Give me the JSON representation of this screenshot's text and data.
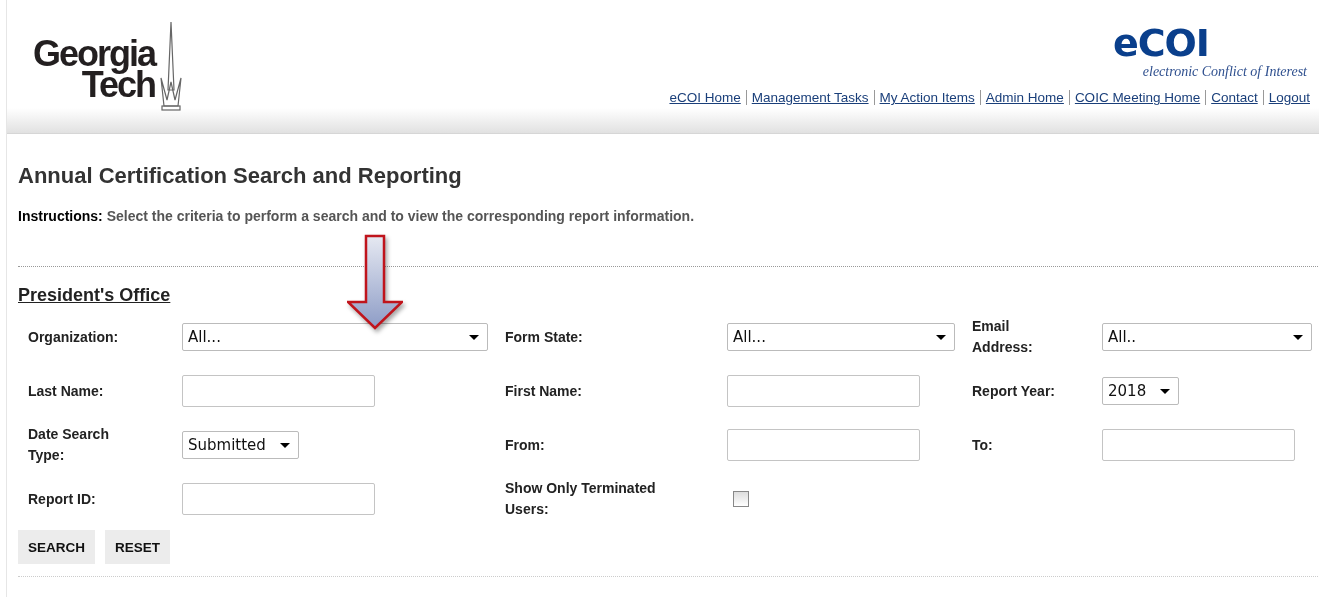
{
  "header": {
    "logo": {
      "line1": "Georgia",
      "line2": "Tech"
    },
    "app_logo": {
      "name": "eCOI",
      "tagline": "electronic Conflict of Interest"
    },
    "nav_links": [
      "eCOI Home",
      "Management Tasks",
      "My Action Items",
      "Admin Home",
      "COIC Meeting Home",
      "Contact",
      "Logout"
    ]
  },
  "page": {
    "title": "Annual Certification Search and Reporting",
    "instructions": "**Instructions:** Select the criteria to perform a search and to view the corresponding report information.",
    "section": "President's Office",
    "fields": [
      {
        "label": "Organization:",
        "kind": "select",
        "value": "All..."
      },
      {
        "label": "Form State:",
        "kind": "select",
        "value": "All..."
      },
      {
        "label": "Email Address:",
        "kind": "select",
        "value": "All.."
      },
      {
        "label": "Last Name:",
        "kind": "text"
      },
      {
        "label": "First Name:",
        "kind": "text"
      },
      {
        "label": "Report Year:",
        "kind": "select",
        "value": "2018"
      },
      {
        "label": "Date Search Type:",
        "kind": "select",
        "value": "Submitted"
      },
      {
        "label": "From:",
        "kind": "text"
      },
      {
        "label": "To:",
        "kind": "text"
      },
      {
        "label": "Report ID:",
        "kind": "text"
      },
      {
        "label": "Show Only Terminated Users:",
        "kind": "checkbox",
        "checked": false
      }
    ],
    "buttons": [
      "SEARCH",
      "RESET"
    ]
  },
  "annotation": {
    "kind": "arrow"
  }
}
